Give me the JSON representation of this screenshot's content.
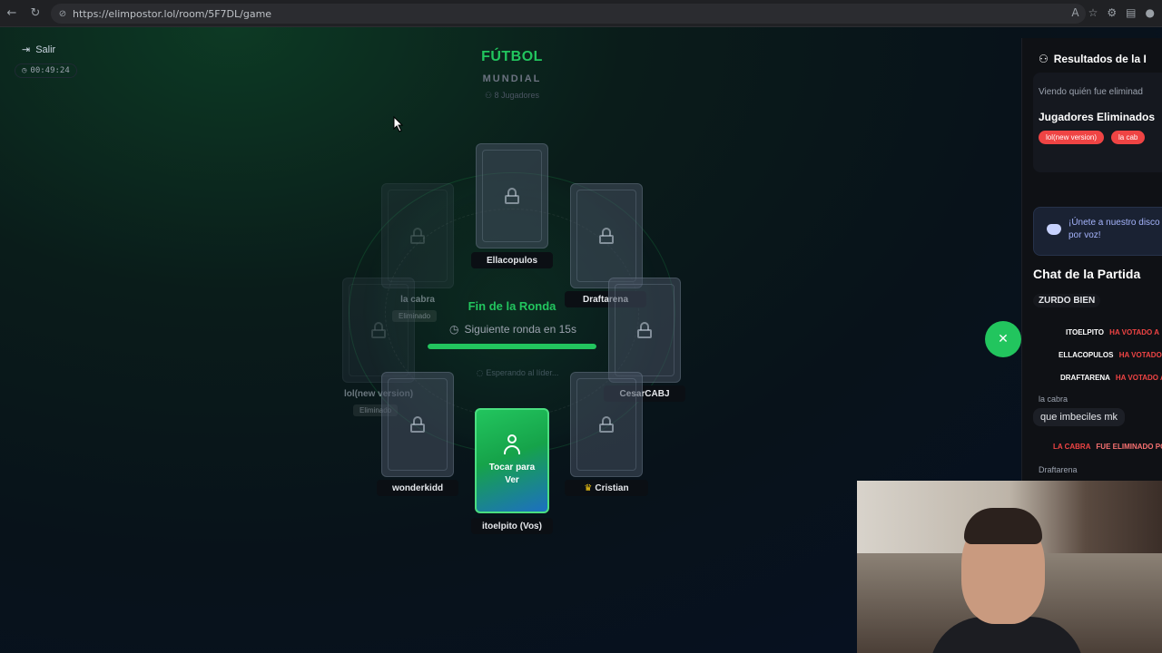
{
  "browser": {
    "url": "https://elimpostor.lol/room/5F7DL/game",
    "back_icon": "arrow-left-icon",
    "reload_icon": "reload-icon"
  },
  "header": {
    "exit_label": "Salir",
    "timer": "00:49:24",
    "title": "FÚTBOL",
    "subtitle": "MUNDIAL",
    "players_count": "8 Jugadores"
  },
  "players": {
    "top": "Ellacopulos",
    "top_right": "Draftarena",
    "right": "CesarCABJ",
    "bottom_right": "Cristian",
    "bottom_right_crown": "♛",
    "me": "itoelpito (Vos)",
    "bottom_left": "wonderkidd",
    "left": "lol(new version)",
    "top_left": "la cabra",
    "eliminated_label": "Eliminado"
  },
  "round": {
    "title": "Fin de la Ronda",
    "next": "Siguiente ronda en 15s",
    "progress": 1.0,
    "waiting": "Esperando al líder..."
  },
  "me_card": {
    "label_line1": "Tocar para",
    "label_line2": "Ver"
  },
  "sidebar": {
    "results_title": "Resultados de la I",
    "results_sub": "Viendo quién fue eliminad",
    "eliminated_title": "Jugadores Eliminados",
    "chips": [
      "lol(new version)",
      "la cab"
    ],
    "discord_line1": "¡Únete a nuestro disco",
    "discord_line2": "por voz!",
    "chat_title": "Chat de la Partida",
    "chat": {
      "msg_top": "ZURDO BIEN",
      "vote1_name": "ITOELPITO",
      "vote1_text": "HA VOTADO A",
      "vote2_name": "ELLACOPULOS",
      "vote2_text": "HA VOTADO A",
      "vote3_name": "DRAFTARENA",
      "vote3_text": "HA VOTADO A",
      "sender": "la cabra",
      "message": "que imbeciles mk",
      "elim_name": "LA CABRA",
      "elim_text": "FUE ELIMINADO PO",
      "sender2": "Draftarena"
    }
  },
  "close_fab": "✕",
  "colors": {
    "accent": "#22c55e",
    "danger": "#ef4444"
  }
}
